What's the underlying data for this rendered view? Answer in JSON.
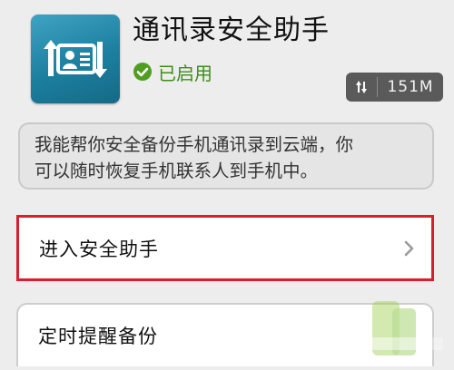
{
  "app": {
    "title": "通讯录安全助手",
    "status": "已启用"
  },
  "sync_badge": {
    "size": "151M"
  },
  "description": {
    "line1": "我能帮你安全备份手机通讯录到云端，你",
    "line2": "可以随时恢复手机联系人到手机中。"
  },
  "menu": [
    {
      "label": "进入安全助手"
    },
    {
      "label": "定时提醒备份"
    }
  ],
  "colors": {
    "icon_bg": "#1c7f9f",
    "status_green": "#3e8d16",
    "highlight_red": "#d8202c",
    "badge_bg": "#5a5a5a"
  }
}
